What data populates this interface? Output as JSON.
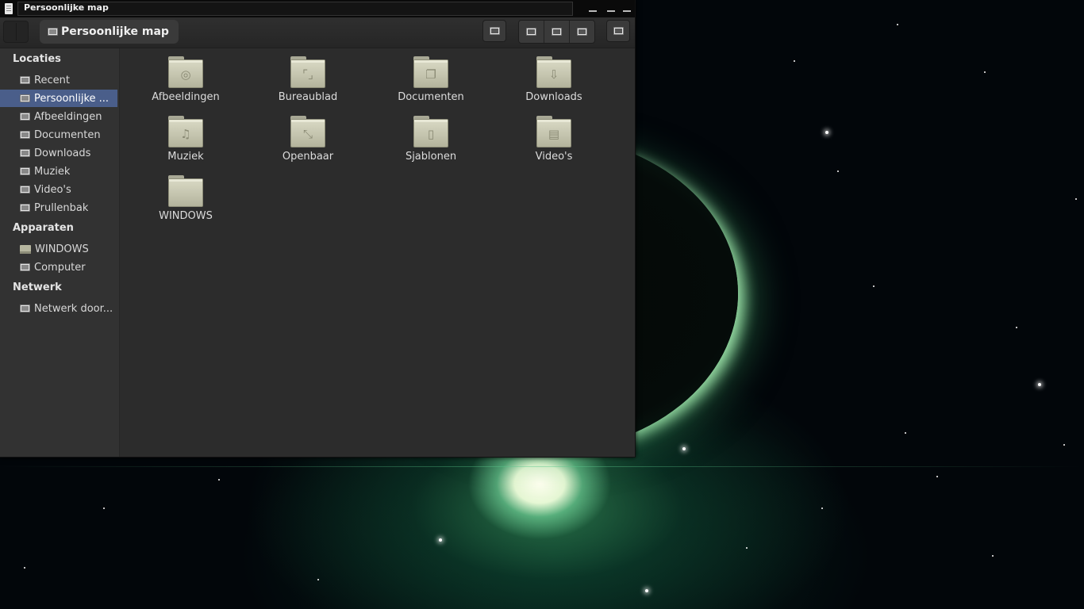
{
  "window": {
    "title": "Persoonlijke map",
    "minimize_icon": "minimize-icon",
    "maximize_icon": "maximize-icon",
    "close_icon": "close-icon"
  },
  "toolbar": {
    "location": "Persoonlijke map",
    "buttons": [
      "search-icon",
      "icon-view-icon",
      "list-view-icon",
      "compact-view-icon",
      "menu-icon"
    ]
  },
  "sidebar": {
    "sections": [
      {
        "title": "Locaties",
        "items": [
          {
            "label": "Recent",
            "icon": "recent-icon"
          },
          {
            "label": "Persoonlijke ...",
            "icon": "home-icon",
            "active": true
          },
          {
            "label": "Afbeeldingen",
            "icon": "pictures-icon"
          },
          {
            "label": "Documenten",
            "icon": "documents-icon"
          },
          {
            "label": "Downloads",
            "icon": "downloads-icon"
          },
          {
            "label": "Muziek",
            "icon": "music-icon"
          },
          {
            "label": "Video's",
            "icon": "videos-icon"
          },
          {
            "label": "Prullenbak",
            "icon": "trash-icon"
          }
        ]
      },
      {
        "title": "Apparaten",
        "items": [
          {
            "label": "WINDOWS",
            "icon": "drive-icon"
          },
          {
            "label": "Computer",
            "icon": "computer-icon"
          }
        ]
      },
      {
        "title": "Netwerk",
        "items": [
          {
            "label": "Netwerk door...",
            "icon": "network-icon"
          }
        ]
      }
    ]
  },
  "files": [
    {
      "label": "Afbeeldingen",
      "icon": "camera-folder-icon",
      "glyph": "◎"
    },
    {
      "label": "Bureaublad",
      "icon": "desktop-folder-icon",
      "glyph": "⌜⌟"
    },
    {
      "label": "Documenten",
      "icon": "documents-folder-icon",
      "glyph": "❐"
    },
    {
      "label": "Downloads",
      "icon": "download-folder-icon",
      "glyph": "⇩"
    },
    {
      "label": "Muziek",
      "icon": "music-folder-icon",
      "glyph": "♫"
    },
    {
      "label": "Openbaar",
      "icon": "public-folder-icon",
      "glyph": "⤡"
    },
    {
      "label": "Sjablonen",
      "icon": "templates-folder-icon",
      "glyph": "▯"
    },
    {
      "label": "Video's",
      "icon": "video-folder-icon",
      "glyph": "▤"
    },
    {
      "label": "WINDOWS",
      "icon": "folder-icon",
      "glyph": ""
    }
  ]
}
